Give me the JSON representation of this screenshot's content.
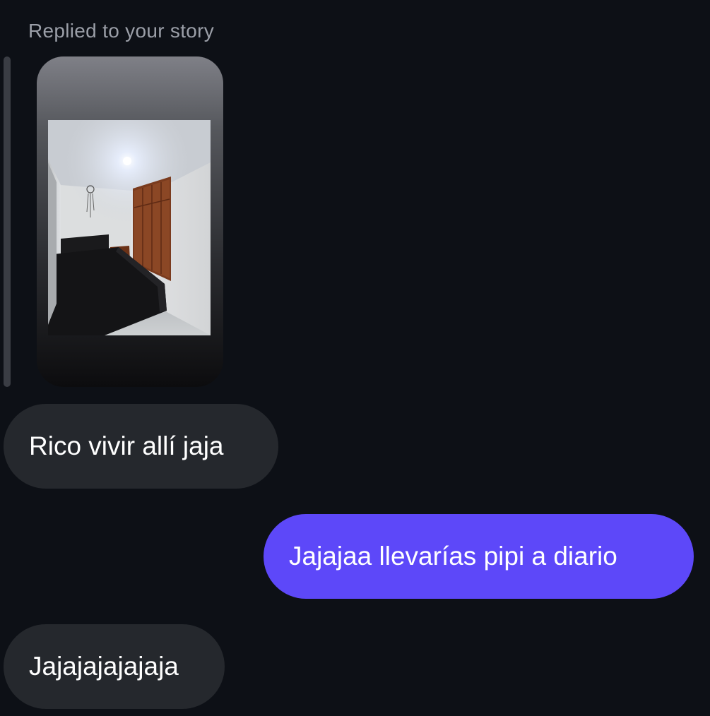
{
  "thread": {
    "replied_label": "Replied to your story",
    "story": {
      "thumbnail_description": "bedroom-story-photo"
    },
    "messages": [
      {
        "direction": "incoming",
        "text": "Rico vivir allí jaja"
      },
      {
        "direction": "outgoing",
        "text": "Jajajaa llevarías pipi a diario"
      },
      {
        "direction": "incoming",
        "text": "Jajajajajajaja"
      }
    ]
  },
  "colors": {
    "background": "#0d1016",
    "incoming_bubble": "#25282d",
    "outgoing_bubble": "#5d48f9",
    "muted_text": "#9b9fa8"
  }
}
